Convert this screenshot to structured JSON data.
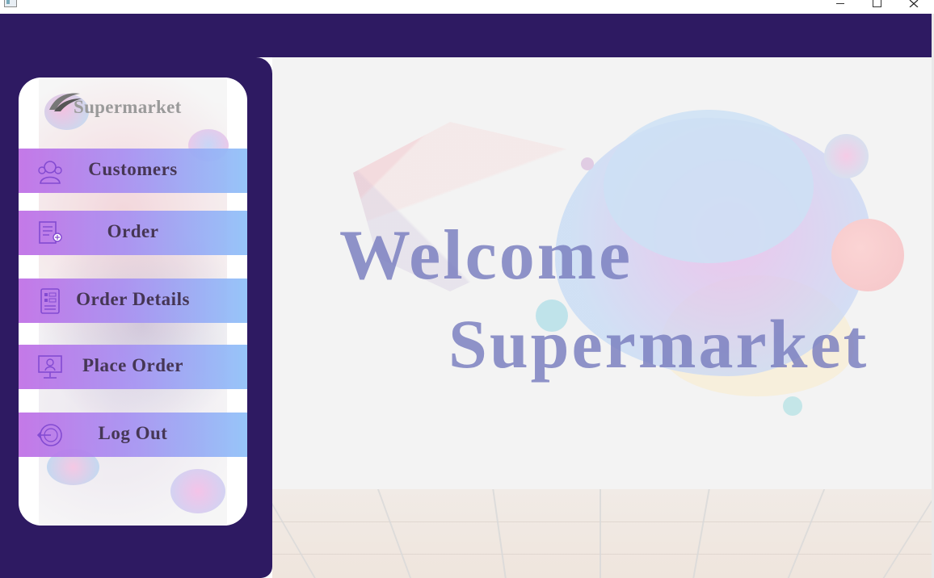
{
  "app": {
    "logo_text": "Supermarket"
  },
  "window_controls": {
    "minimize": "–",
    "maximize": "□",
    "close": "✕"
  },
  "menu": {
    "items": [
      {
        "label": "Customers",
        "icon": "customers-icon"
      },
      {
        "label": "Order",
        "icon": "order-icon"
      },
      {
        "label": "Order Details",
        "icon": "order-details-icon"
      },
      {
        "label": "Place Order",
        "icon": "place-order-icon"
      },
      {
        "label": "Log Out",
        "icon": "logout-icon"
      }
    ]
  },
  "hero": {
    "line1": "Welcome",
    "line2": "Supermarket"
  },
  "colors": {
    "header": "#2e1a62",
    "sidebar": "#2e1a62",
    "button_gradient_start": "#c06fe6",
    "button_gradient_end": "#8fc0f8",
    "hero_text": "#787dbe"
  }
}
